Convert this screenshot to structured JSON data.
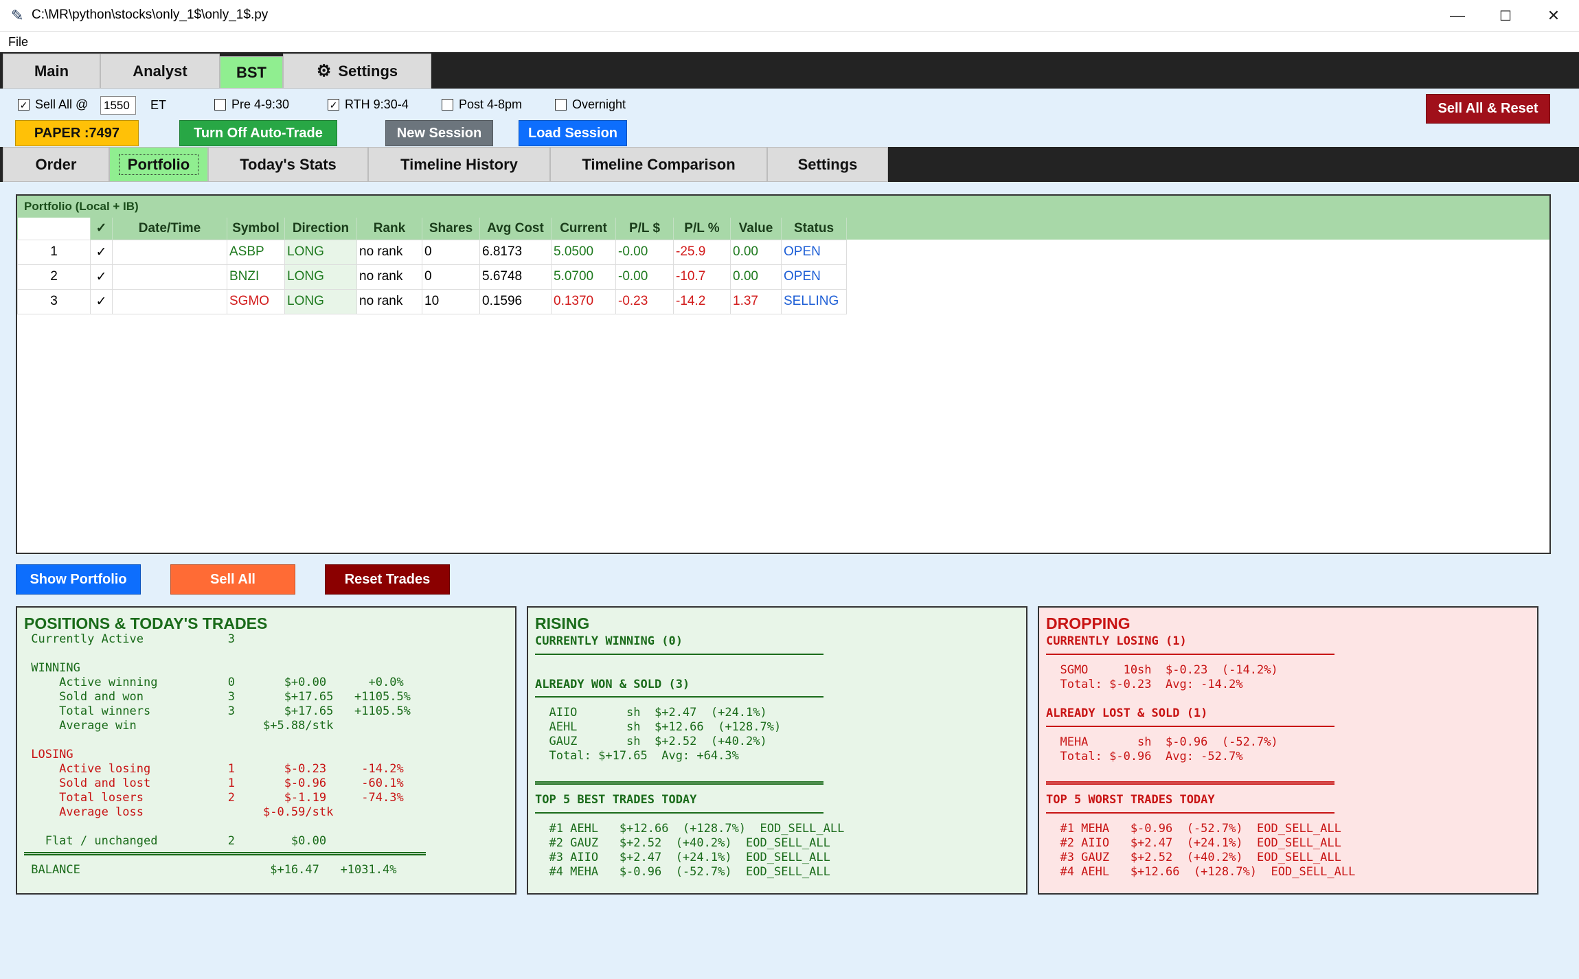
{
  "window": {
    "title": "C:\\MR\\python\\stocks\\only_1$\\only_1$.py",
    "minimize": "—",
    "maximize": "☐",
    "close": "✕"
  },
  "menu": {
    "file": "File"
  },
  "top_tabs": [
    "Main",
    "Analyst",
    "BST",
    "Settings"
  ],
  "top_tabs_active": "BST",
  "options": {
    "sell_all_label": "Sell All @",
    "sell_all_checked": true,
    "sell_all_time": "1550",
    "tz": "ET",
    "pre_label": "Pre 4-9:30",
    "pre_checked": false,
    "rth_label": "RTH 9:30-4",
    "rth_checked": true,
    "post_label": "Post 4-8pm",
    "post_checked": false,
    "overnight_label": "Overnight",
    "overnight_checked": false
  },
  "buttons": {
    "paper": "PAPER :7497",
    "auto_trade": "Turn Off Auto-Trade",
    "new_session": "New Session",
    "load_session": "Load Session",
    "sell_all_reset": "Sell All & Reset",
    "show_portfolio": "Show Portfolio",
    "sell_all": "Sell All",
    "reset_trades": "Reset Trades"
  },
  "colors": {
    "paper": "#ffc107",
    "auto_trade": "#28a745",
    "new_session": "#6c757d",
    "load_session": "#0d6efd",
    "sell_all_reset": "#a0101a",
    "show_portfolio": "#0d6efd",
    "sell_all": "#ff6b35",
    "reset_trades": "#8b0000"
  },
  "sub_tabs": [
    "Order",
    "Portfolio",
    "Today's Stats",
    "Timeline History",
    "Timeline Comparison",
    "Settings"
  ],
  "sub_tabs_active": "Portfolio",
  "portfolio": {
    "title": "Portfolio (Local + IB)",
    "columns": [
      "✓",
      "Date/Time",
      "Symbol",
      "Direction",
      "Rank",
      "Shares",
      "Avg Cost",
      "Current",
      "P/L $",
      "P/L %",
      "Value",
      "Status"
    ],
    "rows": [
      {
        "n": "1",
        "check": "✓",
        "datetime": "",
        "symbol": "ASBP",
        "direction": "LONG",
        "rank": "no rank",
        "shares": "0",
        "avg": "6.8173",
        "current": "5.0500",
        "pl": "-0.00",
        "plpct": "-25.9",
        "value": "0.00",
        "status": "OPEN"
      },
      {
        "n": "2",
        "check": "✓",
        "datetime": "",
        "symbol": "BNZI",
        "direction": "LONG",
        "rank": "no rank",
        "shares": "0",
        "avg": "5.6748",
        "current": "5.0700",
        "pl": "-0.00",
        "plpct": "-10.7",
        "value": "0.00",
        "status": "OPEN"
      },
      {
        "n": "3",
        "check": "✓",
        "datetime": "",
        "symbol": "SGMO",
        "direction": "LONG",
        "rank": "no rank",
        "shares": "10",
        "avg": "0.1596",
        "current": "0.1370",
        "pl": "-0.23",
        "plpct": "-14.2",
        "value": "1.37",
        "status": "SELLING"
      }
    ]
  },
  "positions": {
    "title": "POSITIONS & TODAY'S TRADES",
    "lines": [
      " Currently Active            3",
      "",
      " WINNING",
      "     Active winning          0       $+0.00      +0.0%",
      "     Sold and won            3       $+17.65   +1105.5%",
      "     Total winners           3       $+17.65   +1105.5%",
      "     Average win                  $+5.88/stk",
      "",
      " LOSING",
      "     Active losing           1       $-0.23     -14.2%",
      "     Sold and lost           1       $-0.96     -60.1%",
      "     Total losers            2       $-1.19     -74.3%",
      "     Average loss                 $-0.59/stk",
      "",
      "   Flat / unchanged          2        $0.00",
      "",
      " BALANCE                           $+16.47   +1031.4%"
    ]
  },
  "rising": {
    "title": "RISING",
    "currently": "CURRENTLY WINNING (0)",
    "already": "ALREADY WON & SOLD (3)",
    "already_lines": [
      "  AIIO       sh  $+2.47  (+24.1%)",
      "  AEHL       sh  $+12.66  (+128.7%)",
      "  GAUZ       sh  $+2.52  (+40.2%)",
      "  Total: $+17.65  Avg: +64.3%"
    ],
    "top_title": "TOP 5 BEST TRADES TODAY",
    "top_lines": [
      "  #1 AEHL   $+12.66  (+128.7%)  EOD_SELL_ALL",
      "  #2 GAUZ   $+2.52  (+40.2%)  EOD_SELL_ALL",
      "  #3 AIIO   $+2.47  (+24.1%)  EOD_SELL_ALL",
      "  #4 MEHA   $-0.96  (-52.7%)  EOD_SELL_ALL"
    ]
  },
  "dropping": {
    "title": "DROPPING",
    "currently": "CURRENTLY LOSING (1)",
    "currently_lines": [
      "  SGMO     10sh  $-0.23  (-14.2%)",
      "  Total: $-0.23  Avg: -14.2%"
    ],
    "already": "ALREADY LOST & SOLD (1)",
    "already_lines": [
      "  MEHA       sh  $-0.96  (-52.7%)",
      "  Total: $-0.96  Avg: -52.7%"
    ],
    "top_title": "TOP 5 WORST TRADES TODAY",
    "top_lines": [
      "  #1 MEHA   $-0.96  (-52.7%)  EOD_SELL_ALL",
      "  #2 AIIO   $+2.47  (+24.1%)  EOD_SELL_ALL",
      "  #3 GAUZ   $+2.52  (+40.2%)  EOD_SELL_ALL",
      "  #4 AEHL   $+12.66  (+128.7%)  EOD_SELL_ALL"
    ]
  }
}
